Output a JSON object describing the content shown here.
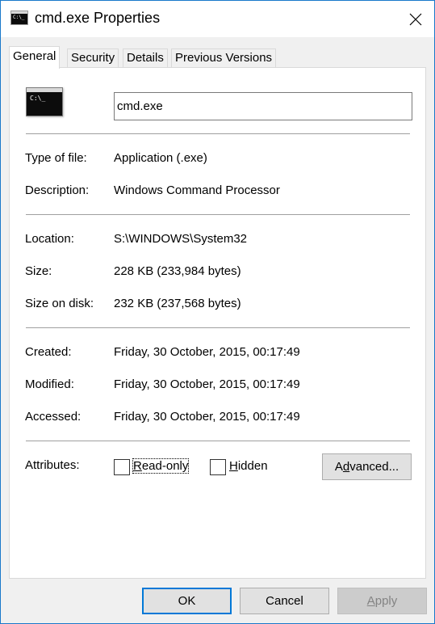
{
  "window": {
    "title": "cmd.exe Properties",
    "icon": "console-app-icon",
    "close_icon": "close-x-icon",
    "accent_color": "#1979ca"
  },
  "tabs": [
    {
      "label": "General",
      "active": true
    },
    {
      "label": "Security",
      "active": false
    },
    {
      "label": "Details",
      "active": false
    },
    {
      "label": "Previous Versions",
      "active": false
    }
  ],
  "general": {
    "file_icon": "console-file-icon",
    "filename": "cmd.exe",
    "rows": {
      "type_label": "Type of file:",
      "type_value": "Application (.exe)",
      "description_label": "Description:",
      "description_value": "Windows Command Processor",
      "location_label": "Location:",
      "location_value": "S:\\WINDOWS\\System32",
      "size_label": "Size:",
      "size_value": "228 KB (233,984 bytes)",
      "size_on_disk_label": "Size on disk:",
      "size_on_disk_value": "232 KB (237,568 bytes)",
      "created_label": "Created:",
      "created_value": "Friday, 30 October, 2015, 00:17:49",
      "modified_label": "Modified:",
      "modified_value": "Friday, 30 October, 2015, 00:17:49",
      "accessed_label": "Accessed:",
      "accessed_value": "Friday, 30 October, 2015, 00:17:49"
    },
    "attributes": {
      "label": "Attributes:",
      "readonly_accel": "R",
      "readonly_rest": "ead-only",
      "readonly_checked": false,
      "hidden_accel": "H",
      "hidden_rest": "idden",
      "hidden_checked": false,
      "advanced_pre": "A",
      "advanced_accel": "d",
      "advanced_rest": "vanced..."
    }
  },
  "footer": {
    "ok": "OK",
    "cancel": "Cancel",
    "apply_accel": "A",
    "apply_rest": "pply",
    "apply_disabled": true
  }
}
